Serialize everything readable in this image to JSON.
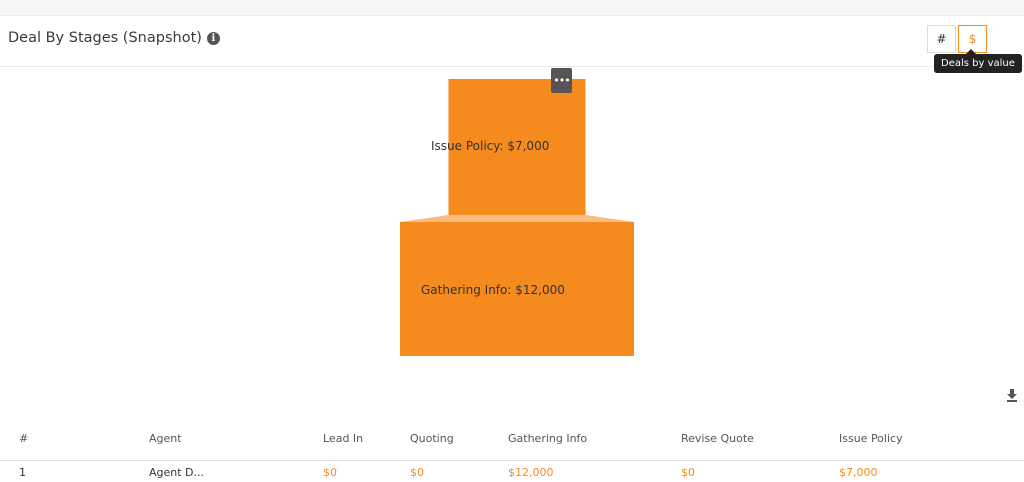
{
  "header": {
    "title": "Deal By Stages (Snapshot)",
    "toggle_count_label": "#",
    "toggle_value_label": "$",
    "tooltip": "Deals by value"
  },
  "icons": {
    "info": "info-circle-icon",
    "menu": "ellipsis-icon",
    "download": "download-icon"
  },
  "colors": {
    "accent": "#f58a1f",
    "connector": "#f9bb80"
  },
  "chart_data": {
    "type": "funnel",
    "stages": [
      {
        "name": "Issue Policy",
        "label": "Issue Policy: $7,000",
        "value": 7000
      },
      {
        "name": "Gathering Info",
        "label": "Gathering Info: $12,000",
        "value": 12000
      }
    ]
  },
  "table": {
    "columns": [
      "#",
      "Agent",
      "Lead In",
      "Quoting",
      "Gathering Info",
      "Revise Quote",
      "Issue Policy"
    ],
    "rows": [
      [
        "1",
        "Agent D...",
        "$0",
        "$0",
        "$12,000",
        "$0",
        "$7,000"
      ]
    ]
  }
}
